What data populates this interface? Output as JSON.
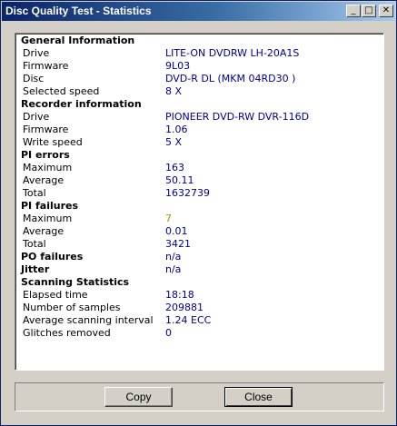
{
  "window": {
    "title": "Disc Quality Test - Statistics",
    "controls": {
      "minimize": "_",
      "maximize": "□",
      "close": "✕"
    }
  },
  "stats": {
    "general_header": "General Information",
    "drive_label": "Drive",
    "drive_value": "LITE-ON DVDRW LH-20A1S",
    "firmware_label": "Firmware",
    "firmware_value": "9L03",
    "disc_label": "Disc",
    "disc_value": "DVD-R DL (MKM 04RD30  )",
    "speed_label": "Selected speed",
    "speed_value": "8 X",
    "recorder_header": "Recorder information",
    "rec_drive_label": "Drive",
    "rec_drive_value": "PIONEER DVD-RW  DVR-116D",
    "rec_firmware_label": "Firmware",
    "rec_firmware_value": "1.06",
    "rec_speed_label": "Write speed",
    "rec_speed_value": "5 X",
    "pie_header": "PI errors",
    "pie_max_label": "Maximum",
    "pie_max_value": "163",
    "pie_avg_label": "Average",
    "pie_avg_value": "50.11",
    "pie_total_label": "Total",
    "pie_total_value": "1632739",
    "pif_header": "PI failures",
    "pif_max_label": "Maximum",
    "pif_max_value": "7",
    "pif_avg_label": "Average",
    "pif_avg_value": "0.01",
    "pif_total_label": "Total",
    "pif_total_value": "3421",
    "po_header": "PO failures",
    "po_value": "n/a",
    "jitter_header": "Jitter",
    "jitter_value": "n/a",
    "scan_header": "Scanning Statistics",
    "elapsed_label": "Elapsed time",
    "elapsed_value": "18:18",
    "samples_label": "Number of samples",
    "samples_value": "209881",
    "interval_label": "Average scanning interval",
    "interval_value": "1.24 ECC",
    "glitches_label": "Glitches removed",
    "glitches_value": "0"
  },
  "buttons": {
    "copy": "Copy",
    "close": "Close"
  }
}
